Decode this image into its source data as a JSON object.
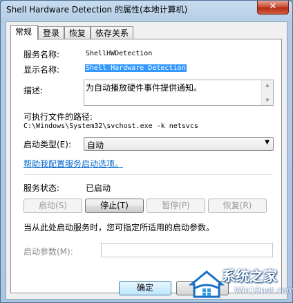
{
  "window": {
    "title": "Shell Hardware Detection 的属性(本地计算机)",
    "close_label": "✕"
  },
  "tabs": [
    {
      "label": "常规"
    },
    {
      "label": "登录"
    },
    {
      "label": "恢复"
    },
    {
      "label": "依存关系"
    }
  ],
  "general": {
    "service_name_label": "服务名称:",
    "service_name_value": "ShellHWDetection",
    "display_name_label": "显示名称:",
    "display_name_value": "Shell Hardware Detection",
    "description_label": "描述:",
    "description_value": "为自动播放硬件事件提供通知。",
    "exe_path_label": "可执行文件的路径:",
    "exe_path_value": "C:\\Windows\\System32\\svchost.exe -k netsvcs",
    "startup_type_label": "启动类型(E):",
    "startup_type_value": "自动",
    "help_link": "帮助我配置服务启动选项。",
    "status_label": "服务状态:",
    "status_value": "已启动",
    "buttons": {
      "start": "启动(S)",
      "stop": "停止(T)",
      "pause": "暂停(P)",
      "resume": "恢复(R)"
    },
    "hint_text": "当从此处启动服务时，您可指定所适用的启动参数。",
    "start_params_label": "启动参数(M):",
    "start_params_value": ""
  },
  "footer": {
    "ok_label": "确定"
  },
  "watermark": {
    "title": "系统之家",
    "url": "Win10net.com",
    "accent": "#1a6fc4"
  }
}
